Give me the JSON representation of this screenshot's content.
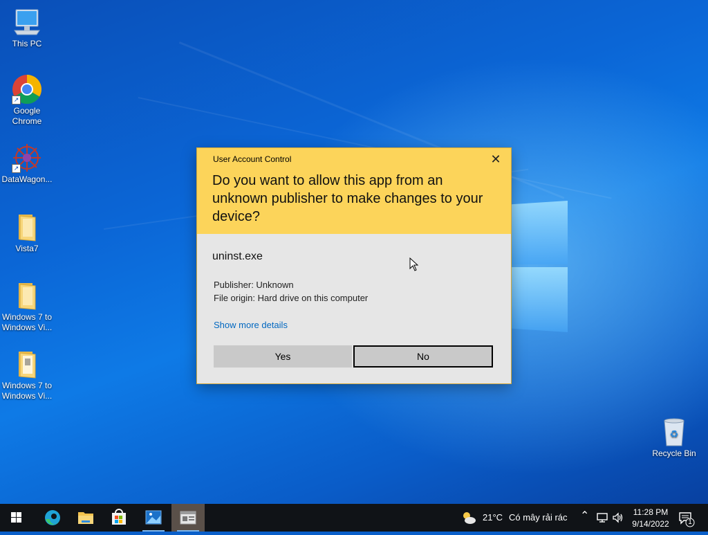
{
  "desktop": {
    "icons": [
      {
        "label": "This PC",
        "name": "this-pc-icon"
      },
      {
        "label": "Google\nChrome",
        "name": "google-chrome-icon"
      },
      {
        "label": "DataWagon...",
        "name": "datawagon-icon"
      },
      {
        "label": "Vista7",
        "name": "folder-icon"
      },
      {
        "label": "Windows 7 to\nWindows Vi...",
        "name": "folder-icon"
      },
      {
        "label": "Windows 7 to\nWindows Vi...",
        "name": "folder-icon"
      },
      {
        "label": "Recycle Bin",
        "name": "recycle-bin-icon"
      }
    ]
  },
  "uac": {
    "title": "User Account Control",
    "close_glyph": "✕",
    "question": "Do you want to allow this app from an unknown publisher to make changes to your device?",
    "app_name": "uninst.exe",
    "publisher": "Publisher: Unknown",
    "origin": "File origin: Hard drive on this computer",
    "more_details": "Show more details",
    "yes_label": "Yes",
    "no_label": "No",
    "header_color": "#fcd45a"
  },
  "taskbar": {
    "apps": [
      {
        "name": "start-button",
        "icon": "windows-icon"
      },
      {
        "name": "taskbar-edge",
        "icon": "edge-icon"
      },
      {
        "name": "taskbar-file-explorer",
        "icon": "folder-icon"
      },
      {
        "name": "taskbar-store",
        "icon": "store-icon"
      },
      {
        "name": "taskbar-photos",
        "icon": "photos-icon"
      },
      {
        "name": "taskbar-uac-window",
        "icon": "window-icon",
        "active": true
      }
    ],
    "weather_temp": "21°C",
    "weather_desc": "Có mây rải rác",
    "time": "11:28 PM",
    "date": "9/14/2022",
    "notification_count": "1"
  }
}
